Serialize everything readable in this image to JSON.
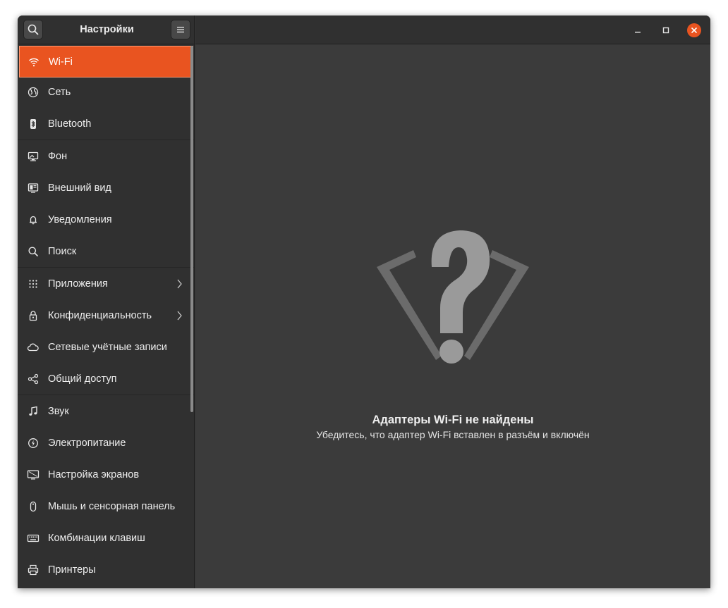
{
  "header": {
    "title": "Настройки",
    "search_icon": "search-icon",
    "menu_icon": "hamburger-menu-icon"
  },
  "window_controls": [
    "minimize-icon",
    "maximize-icon",
    "close-icon"
  ],
  "sidebar": {
    "items": [
      {
        "label": "Wi-Fi",
        "icon": "wifi-icon",
        "active": true
      },
      {
        "label": "Сеть",
        "icon": "globe-icon"
      },
      {
        "label": "Bluetooth",
        "icon": "bluetooth-icon"
      },
      {
        "label": "Фон",
        "icon": "monitor-background-icon"
      },
      {
        "label": "Внешний вид",
        "icon": "appearance-icon"
      },
      {
        "label": "Уведомления",
        "icon": "bell-icon"
      },
      {
        "label": "Поиск",
        "icon": "search-icon"
      },
      {
        "label": "Приложения",
        "icon": "apps-grid-icon",
        "has_submenu": true
      },
      {
        "label": "Конфиденциальность",
        "icon": "lock-icon",
        "has_submenu": true
      },
      {
        "label": "Сетевые учётные записи",
        "icon": "cloud-icon"
      },
      {
        "label": "Общий доступ",
        "icon": "share-icon"
      },
      {
        "label": "Звук",
        "icon": "music-note-icon"
      },
      {
        "label": "Электропитание",
        "icon": "power-icon"
      },
      {
        "label": "Настройка экранов",
        "icon": "display-icon"
      },
      {
        "label": "Мышь и сенсорная панель",
        "icon": "mouse-icon"
      },
      {
        "label": "Комбинации клавиш",
        "icon": "keyboard-icon"
      },
      {
        "label": "Принтеры",
        "icon": "printer-icon"
      }
    ]
  },
  "main": {
    "placeholder_icon": "wifi-question-icon",
    "empty_title": "Адаптеры Wi-Fi не найдены",
    "empty_subtitle": "Убедитесь, что адаптер Wi-Fi вставлен в разъём и включён"
  },
  "colors": {
    "accent": "#e95420",
    "sidebar_bg": "#303030",
    "content_bg": "#3b3b3b"
  }
}
